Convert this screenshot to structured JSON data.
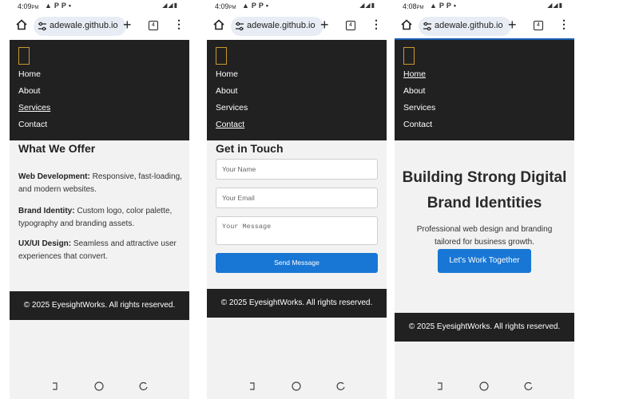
{
  "phones": [
    {
      "status_time": "4:09",
      "status_ampm": "PM",
      "url": "adewale.github.io",
      "tab_count": "4",
      "nav": [
        "Home",
        "About",
        "Services",
        "Contact"
      ],
      "section_title": "What We Offer",
      "items": [
        {
          "label": "Web Development:",
          "text": " Responsive, fast-loading, and modern websites."
        },
        {
          "label": "Brand Identity:",
          "text": " Custom logo, color palette, typography and branding assets."
        },
        {
          "label": "UX/UI Design:",
          "text": " Seamless and attractive user experiences that convert."
        }
      ],
      "footer": "© 2025 EyesightWorks. All rights reserved."
    },
    {
      "status_time": "4:09",
      "status_ampm": "PM",
      "url": "adewale.github.io",
      "tab_count": "4",
      "nav": [
        "Home",
        "About",
        "Services",
        "Contact"
      ],
      "section_title": "Get in Touch",
      "name_placeholder": "Your Name",
      "email_placeholder": "Your Email",
      "message_placeholder": "Your Message",
      "send_label": "Send Message",
      "footer": "© 2025 EyesightWorks. All rights reserved."
    },
    {
      "status_time": "4:08",
      "status_ampm": "PM",
      "url": "adewale.github.io",
      "tab_count": "4",
      "nav": [
        "Home",
        "About",
        "Services",
        "Contact"
      ],
      "hero_title_line1": "Building Strong Digital",
      "hero_title_line2": "Brand Identities",
      "hero_sub_line1": "Professional web design and branding",
      "hero_sub_line2": "tailored for business growth.",
      "cta_label": "Let's Work Together",
      "footer": "© 2025 EyesightWorks. All rights reserved."
    }
  ],
  "colors": {
    "nav_bg": "#212121",
    "accent": "#1877d4",
    "page_bg": "#f2f2f2",
    "logo": "#c99a2e"
  }
}
